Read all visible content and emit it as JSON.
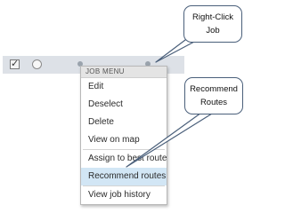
{
  "job_row": {
    "checked": true
  },
  "job_menu": {
    "header": "JOB MENU",
    "items": [
      {
        "label": "Edit",
        "highlighted": false
      },
      {
        "label": "Deselect",
        "highlighted": false
      },
      {
        "label": "Delete",
        "highlighted": false
      },
      {
        "label": "View on map",
        "highlighted": false
      },
      {
        "label": "Assign to best route",
        "highlighted": false
      },
      {
        "label": "Recommend routes",
        "highlighted": true
      },
      {
        "label": "View job history",
        "highlighted": false
      }
    ]
  },
  "callouts": {
    "right_click": {
      "line1": "Right-Click",
      "line2": "Job"
    },
    "recommend": {
      "line1": "Recommend",
      "line2": "Routes"
    }
  },
  "colors": {
    "row_background": "#dde1e7",
    "highlight": "#d2e6f5",
    "callout_border": "#4a5f7a"
  }
}
